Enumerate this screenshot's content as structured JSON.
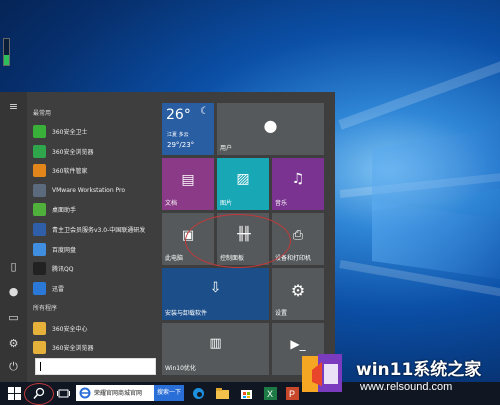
{
  "start_menu": {
    "section_most_used": "最常用",
    "most_used_apps": [
      {
        "label": "360安全卫士",
        "icon": "shield-icon",
        "color": "#38b03a"
      },
      {
        "label": "360安全浏览器",
        "icon": "browser-icon",
        "color": "#2fa64c"
      },
      {
        "label": "360软件管家",
        "icon": "software-manager-icon",
        "color": "#e2861c"
      },
      {
        "label": "VMware Workstation Pro",
        "icon": "vmware-icon",
        "color": "#5b6a7c"
      },
      {
        "label": "桌面助手",
        "icon": "desktop-helper-icon",
        "color": "#4fb03c"
      },
      {
        "label": "青主卫会员服务v3.0-中国联通研发",
        "icon": "service-icon",
        "color": "#2f5fa8"
      },
      {
        "label": "百度网盘",
        "icon": "cloud-drive-icon",
        "color": "#3f8ee0"
      },
      {
        "label": "腾讯QQ",
        "icon": "qq-icon",
        "color": "#222222"
      },
      {
        "label": "迅雷",
        "icon": "thunder-icon",
        "color": "#2a78d8"
      }
    ],
    "section_all_programs": "所有程序",
    "all_programs": [
      {
        "label": "360安全中心",
        "icon": "folder-icon",
        "color": "#e5b13a"
      },
      {
        "label": "360安全浏览器",
        "icon": "folder-icon",
        "color": "#e5b13a"
      }
    ],
    "search_value": ""
  },
  "tiles": {
    "weather": {
      "temp": "26°",
      "city": "江夏 多云",
      "range": "29°/23°"
    },
    "user": "用户",
    "documents": "文档",
    "pictures": "图片",
    "music": "音乐",
    "this_pc": "此电脑",
    "control_panel": "控制面板",
    "devices_printers": "设备和打印机",
    "install_software": "安装与卸载软件",
    "settings": "设置",
    "win10_optimize": "Win10优化",
    "onenote": ""
  },
  "taskbar": {
    "ie_text": "荣耀官网商城官网",
    "ie_button": "搜索一下"
  },
  "watermark": {
    "title": "win11系统之家",
    "url": "www.relsound.com"
  },
  "gadget": {
    "level": 0.4
  },
  "colors": {
    "tile_default": "#55595b",
    "tile_documents": "#8a3a86",
    "tile_pictures": "#17a7b5",
    "tile_music": "#7a3390",
    "tile_install": "#1c4e8a",
    "tile_weather": "#2a5ea3",
    "taskbar": "#101723"
  }
}
